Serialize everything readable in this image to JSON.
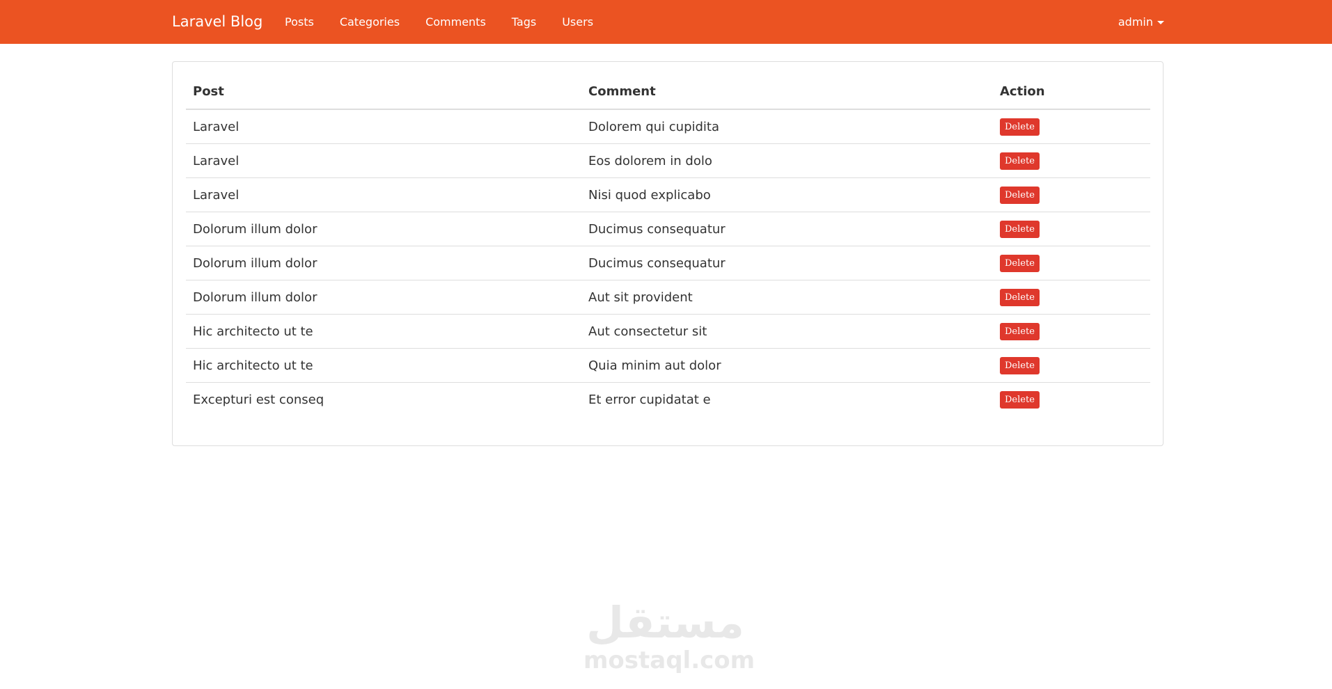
{
  "navbar": {
    "brand": "Laravel Blog",
    "links": [
      "Posts",
      "Categories",
      "Comments",
      "Tags",
      "Users"
    ],
    "user": "admin"
  },
  "table": {
    "headers": [
      "Post",
      "Comment",
      "Action"
    ],
    "rows": [
      {
        "post": "Laravel",
        "comment": "Dolorem qui cupidita",
        "action": "Delete"
      },
      {
        "post": "Laravel",
        "comment": "Eos dolorem in dolo",
        "action": "Delete"
      },
      {
        "post": "Laravel",
        "comment": "Nisi quod explicabo",
        "action": "Delete"
      },
      {
        "post": "Dolorum illum dolor",
        "comment": "Ducimus consequatur",
        "action": "Delete"
      },
      {
        "post": "Dolorum illum dolor",
        "comment": "Ducimus consequatur",
        "action": "Delete"
      },
      {
        "post": "Dolorum illum dolor",
        "comment": "Aut sit provident",
        "action": "Delete"
      },
      {
        "post": "Hic architecto ut te",
        "comment": "Aut consectetur sit",
        "action": "Delete"
      },
      {
        "post": "Hic architecto ut te",
        "comment": "Quia minim aut dolor",
        "action": "Delete"
      },
      {
        "post": "Excepturi est conseq",
        "comment": "Et error cupidatat e",
        "action": "Delete"
      }
    ]
  },
  "watermark": {
    "arabic": "مستقل",
    "latin": "mostaql.com"
  },
  "colors": {
    "navbar": "#eb5322",
    "delete_button": "#df382c"
  }
}
